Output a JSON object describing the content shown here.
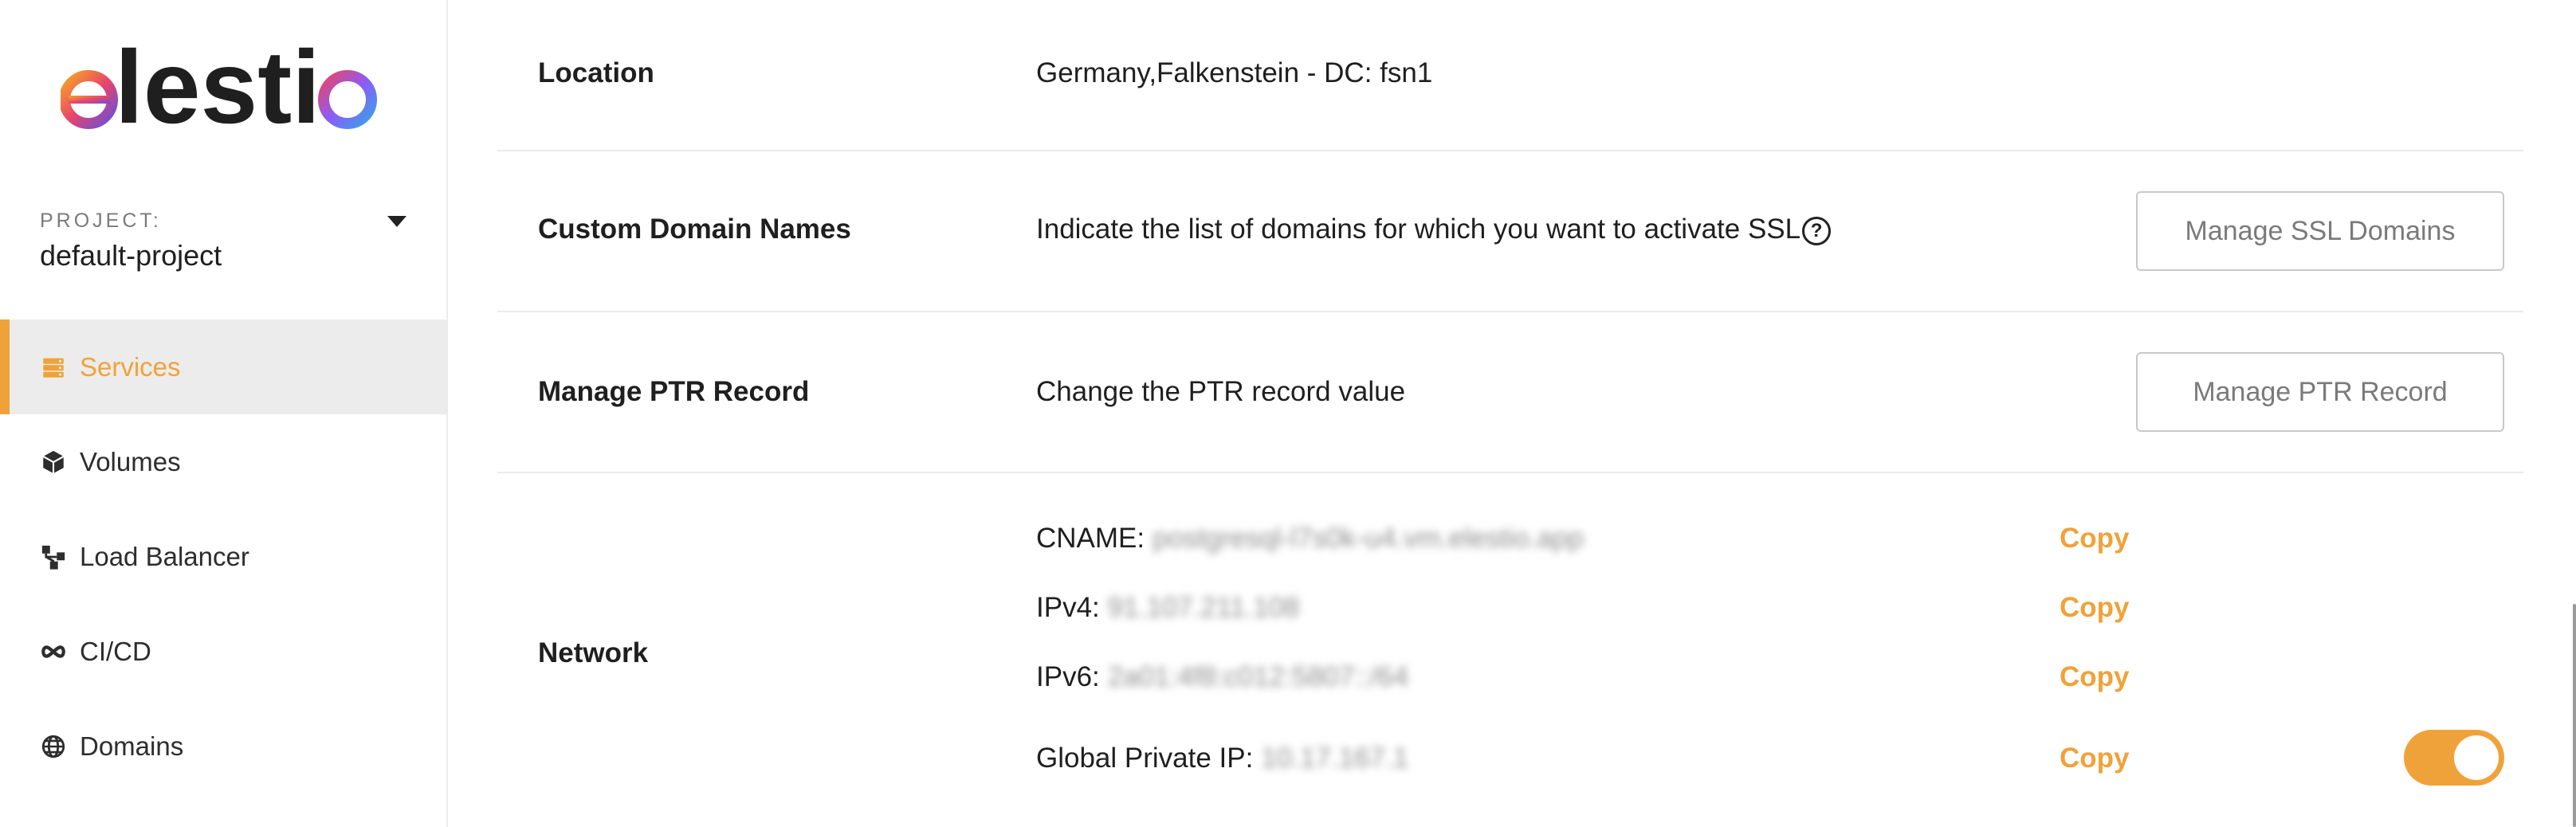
{
  "brand": {
    "logo_text": "elestio",
    "accent": "#f0a23a"
  },
  "sidebar": {
    "project_label": "PROJECT:",
    "project_name": "default-project",
    "items": [
      {
        "label": "Services",
        "icon": "server-icon",
        "active": true
      },
      {
        "label": "Volumes",
        "icon": "box-icon",
        "active": false
      },
      {
        "label": "Load Balancer",
        "icon": "network-icon",
        "active": false
      },
      {
        "label": "CI/CD",
        "icon": "infinity-icon",
        "active": false
      },
      {
        "label": "Domains",
        "icon": "globe-icon",
        "active": false
      }
    ]
  },
  "main": {
    "location": {
      "label": "Location",
      "value": "Germany,Falkenstein - DC: fsn1"
    },
    "custom_domains": {
      "label": "Custom Domain Names",
      "value": "Indicate the list of domains for which you want to activate SSL",
      "help": "?",
      "button": "Manage SSL Domains"
    },
    "ptr": {
      "label": "Manage PTR Record",
      "value": "Change the PTR record value",
      "button": "Manage PTR Record"
    },
    "network": {
      "label": "Network",
      "lines": [
        {
          "key": "CNAME:",
          "value": "postgresql-l7s0k-u4.vm.elestio.app",
          "copy": "Copy"
        },
        {
          "key": "IPv4:",
          "value": "91.107.211.108",
          "copy": "Copy"
        },
        {
          "key": "IPv6:",
          "value": "2a01:4f8:c012:5807::/64",
          "copy": "Copy"
        },
        {
          "key": "Global Private IP:",
          "value": "10.17.167.1",
          "copy": "Copy"
        }
      ],
      "global_private_ip_enabled": true
    }
  }
}
